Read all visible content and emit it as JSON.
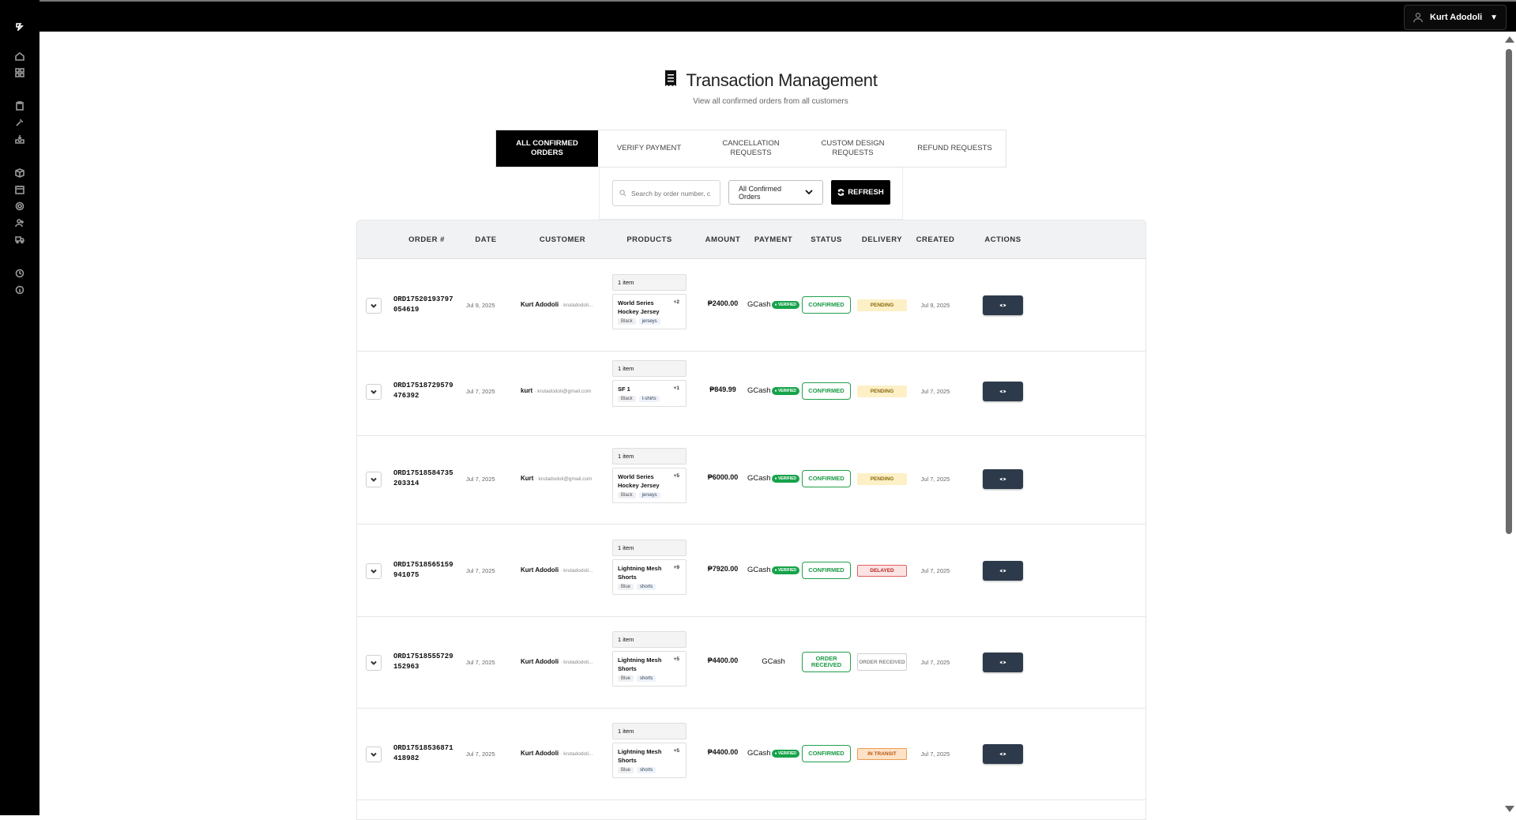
{
  "user_menu": {
    "name": "Kurt Adodoli",
    "caret": "▼"
  },
  "header": {
    "title": "Transaction Management",
    "subtitle": "View all confirmed orders from all customers"
  },
  "tabs": [
    {
      "label": "ALL CONFIRMED ORDERS",
      "active": true
    },
    {
      "label": "VERIFY PAYMENT",
      "active": false
    },
    {
      "label": "CANCELLATION REQUESTS",
      "active": false
    },
    {
      "label": "CUSTOM DESIGN REQUESTS",
      "active": false
    },
    {
      "label": "REFUND REQUESTS",
      "active": false
    }
  ],
  "filters": {
    "search_placeholder": "Search by order number, customer...",
    "select_value": "All Confirmed Orders",
    "refresh_label": "REFRESH"
  },
  "table": {
    "columns": [
      "ORDER #",
      "DATE",
      "CUSTOMER",
      "PRODUCTS",
      "AMOUNT",
      "PAYMENT",
      "STATUS",
      "DELIVERY",
      "CREATED",
      "ACTIONS"
    ],
    "rows": [
      {
        "order_line1": "ORD17520193797",
        "order_line2": "054619",
        "date": "Jul 9, 2025",
        "customer_name": "Kurt Adodoli",
        "customer_email": "krutadodoli...",
        "item_count": "1 item",
        "product_name": "World Series Hockey Jersey",
        "product_more": "+2",
        "tag_color": "Black",
        "tag_category": "jerseys",
        "amount": "₱2400.00",
        "payment_method": "GCash",
        "payment_badge": "● VERIFIED",
        "status": "CONFIRMED",
        "delivery": "PENDING",
        "delivery_kind": "pending",
        "created": "Jul 9, 2025"
      },
      {
        "order_line1": "ORD17518729579",
        "order_line2": "476392",
        "date": "Jul 7, 2025",
        "customer_name": "kurt",
        "customer_email": "krutadodoli@gmail.com",
        "item_count": "1 item",
        "product_name": "SF 1",
        "product_more": "+1",
        "tag_color": "Black",
        "tag_category": "t-shirts",
        "amount": "₱849.99",
        "payment_method": "GCash",
        "payment_badge": "● VERIFIED",
        "status": "CONFIRMED",
        "delivery": "PENDING",
        "delivery_kind": "pending",
        "created": "Jul 7, 2025"
      },
      {
        "order_line1": "ORD17518584735",
        "order_line2": "203314",
        "date": "Jul 7, 2025",
        "customer_name": "Kurt",
        "customer_email": "krutadodoli@gmail.com",
        "item_count": "1 item",
        "product_name": "World Series Hockey Jersey",
        "product_more": "+5",
        "tag_color": "Black",
        "tag_category": "jerseys",
        "amount": "₱6000.00",
        "payment_method": "GCash",
        "payment_badge": "● VERIFIED",
        "status": "CONFIRMED",
        "delivery": "PENDING",
        "delivery_kind": "pending",
        "created": "Jul 7, 2025"
      },
      {
        "order_line1": "ORD17518565159",
        "order_line2": "941075",
        "date": "Jul 7, 2025",
        "customer_name": "Kurt Adodoli",
        "customer_email": "krutadodoli...",
        "item_count": "1 item",
        "product_name": "Lightning Mesh Shorts",
        "product_more": "+9",
        "tag_color": "Blue",
        "tag_category": "shorts",
        "amount": "₱7920.00",
        "payment_method": "GCash",
        "payment_badge": "● VERIFIED",
        "status": "CONFIRMED",
        "delivery": "DELAYED",
        "delivery_kind": "delayed",
        "created": "Jul 7, 2025"
      },
      {
        "order_line1": "ORD17518555729",
        "order_line2": "152963",
        "date": "Jul 7, 2025",
        "customer_name": "Kurt Adodoli",
        "customer_email": "krutadodoli...",
        "item_count": "1 item",
        "product_name": "Lightning Mesh Shorts",
        "product_more": "+5",
        "tag_color": "Blue",
        "tag_category": "shorts",
        "amount": "₱4400.00",
        "payment_method": "GCash",
        "payment_badge": "",
        "status": "ORDER RECEIVED",
        "delivery": "ORDER RECEIVED",
        "delivery_kind": "received",
        "created": "Jul 7, 2025"
      },
      {
        "order_line1": "ORD17518536871",
        "order_line2": "418982",
        "date": "Jul 7, 2025",
        "customer_name": "Kurt Adodoli",
        "customer_email": "krutadodoli...",
        "item_count": "1 item",
        "product_name": "Lightning Mesh Shorts",
        "product_more": "+5",
        "tag_color": "Blue",
        "tag_category": "shorts",
        "amount": "₱4400.00",
        "payment_method": "GCash",
        "payment_badge": "● VERIFIED",
        "status": "CONFIRMED",
        "delivery": "IN TRANSIT",
        "delivery_kind": "transit",
        "created": "Jul 7, 2025"
      }
    ]
  }
}
